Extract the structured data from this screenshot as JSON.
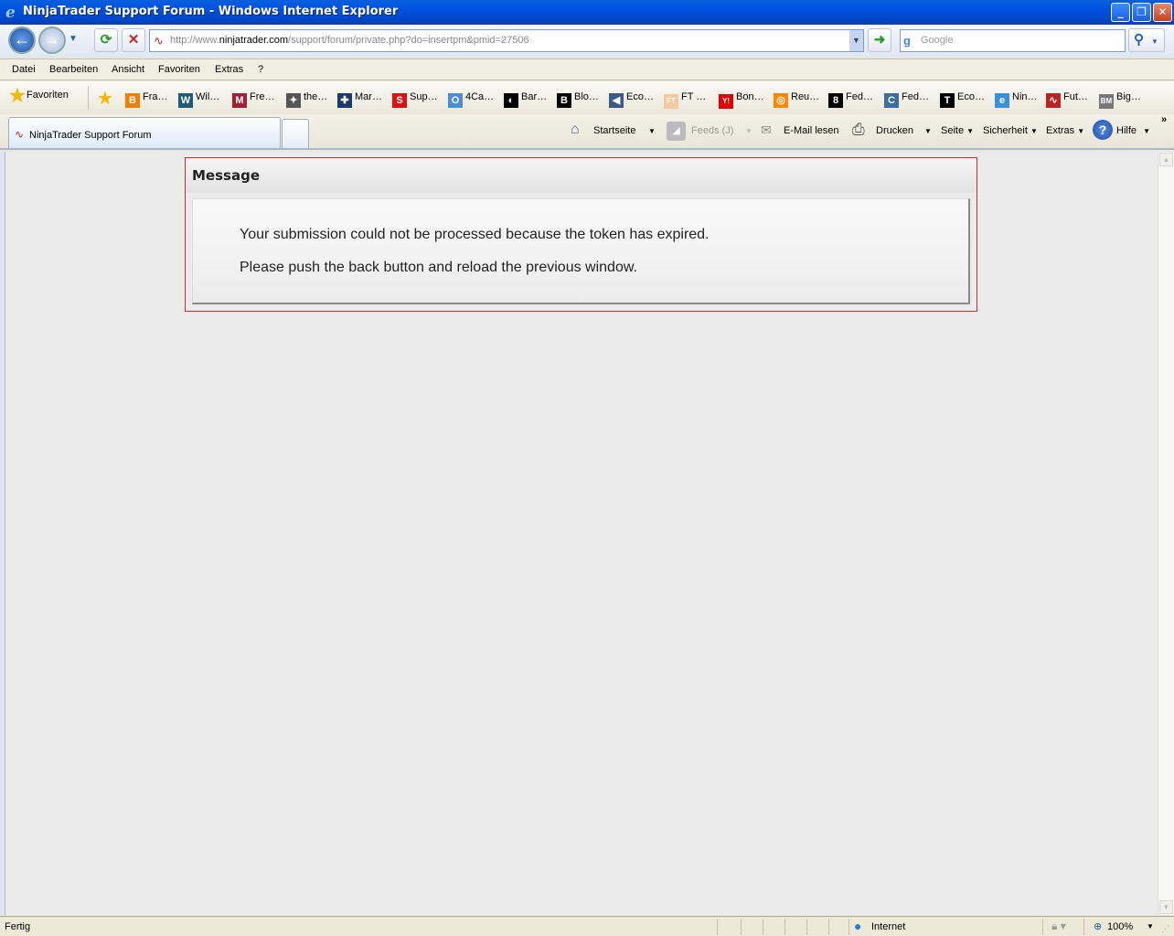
{
  "window": {
    "title": "NinjaTrader Support Forum - Windows Internet Explorer",
    "minimize": "_",
    "restore": "❐",
    "close": "✕"
  },
  "address": {
    "prefix": "http://www.",
    "domain": "ninjatrader.com",
    "path": "/support/forum/private.php?do=insertpm&pmid=27506"
  },
  "search": {
    "placeholder": "Google"
  },
  "menu": [
    "Datei",
    "Bearbeiten",
    "Ansicht",
    "Favoriten",
    "Extras",
    "?"
  ],
  "favorites": {
    "label": "Favoriten",
    "items": [
      {
        "label": "Fra…",
        "icon": "blogger-icon",
        "glyph": "B",
        "color": "#f57d00"
      },
      {
        "label": "Wil…",
        "icon": "wikipedia-icon",
        "glyph": "W",
        "color": "#1e5b78"
      },
      {
        "label": "Fre…",
        "icon": "mit-ocw-icon",
        "glyph": "M",
        "color": "#a31f34"
      },
      {
        "label": "the…",
        "icon": "site-icon",
        "glyph": "✦",
        "color": "#555"
      },
      {
        "label": "Mar…",
        "icon": "site-icon",
        "glyph": "✚",
        "color": "#1a3a6b"
      },
      {
        "label": "Sup…",
        "icon": "site-icon",
        "glyph": "S",
        "color": "#d11"
      },
      {
        "label": "4Ca…",
        "icon": "site-icon",
        "glyph": "O",
        "color": "#4a8fd6"
      },
      {
        "label": "Bar…",
        "icon": "site-icon",
        "glyph": "◐",
        "color": "#000"
      },
      {
        "label": "Blo…",
        "icon": "bloomberg-icon",
        "glyph": "B",
        "color": "#000"
      },
      {
        "label": "Eco…",
        "icon": "site-icon",
        "glyph": "◀",
        "color": "#3a5a8a"
      },
      {
        "label": "FT …",
        "icon": "ft-icon",
        "glyph": "FT",
        "color": "#f7c9a0"
      },
      {
        "label": "Bon…",
        "icon": "yahoo-icon",
        "glyph": "Y!",
        "color": "#d00"
      },
      {
        "label": "Reu…",
        "icon": "reuters-icon",
        "glyph": "◎",
        "color": "#f80"
      },
      {
        "label": "Fed…",
        "icon": "site-icon",
        "glyph": "8",
        "color": "#000"
      },
      {
        "label": "Fed…",
        "icon": "site-icon",
        "glyph": "C",
        "color": "#3b6e9c"
      },
      {
        "label": "Eco…",
        "icon": "nyt-icon",
        "glyph": "T",
        "color": "#000"
      },
      {
        "label": "Nin…",
        "icon": "ie-page-icon",
        "glyph": "e",
        "color": "#3a8fd6"
      },
      {
        "label": "Fut…",
        "icon": "ninjatrader-icon",
        "glyph": "∿",
        "color": "#b22"
      },
      {
        "label": "Big…",
        "icon": "site-icon",
        "glyph": "BM",
        "color": "#777"
      }
    ]
  },
  "tab": {
    "label": "NinjaTrader Support Forum"
  },
  "commandbar": {
    "home": "Startseite",
    "feeds": "Feeds (J)",
    "mail": "E-Mail lesen",
    "print": "Drucken",
    "page": "Seite",
    "safety": "Sicherheit",
    "tools": "Extras",
    "help": "Hilfe",
    "more": "»"
  },
  "message": {
    "title": "Message",
    "line1": "Your submission could not be processed because the token has expired.",
    "line2": "Please push the back button and reload the previous window."
  },
  "status": {
    "text": "Fertig",
    "zone": "Internet",
    "zoom": "100%"
  }
}
